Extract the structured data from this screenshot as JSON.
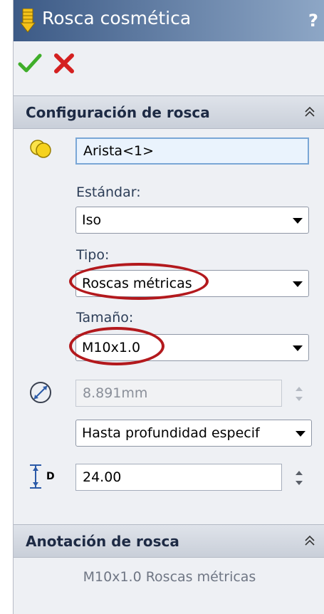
{
  "window": {
    "title": "Rosca cosmética",
    "help_label": "?"
  },
  "actions": {
    "ok_icon": "check-icon",
    "cancel_icon": "x-icon"
  },
  "thread_settings": {
    "header": "Configuración de rosca",
    "edge_value": "Arista<1>",
    "standard_label": "Estándar:",
    "standard_value": "Iso",
    "type_label": "Tipo:",
    "type_value": "Roscas métricas",
    "size_label": "Tamaño:",
    "size_value": "M10x1.0",
    "diameter_value": "8.891mm",
    "end_condition_value": "Hasta profundidad especif",
    "depth_icon_label": "D",
    "depth_value": "24.00"
  },
  "thread_callout": {
    "header": "Anotación de rosca",
    "text": "M10x1.0 Roscas métricas"
  },
  "colors": {
    "highlight": "#b3191d",
    "ok": "#3fae2a",
    "cancel": "#d42020"
  }
}
